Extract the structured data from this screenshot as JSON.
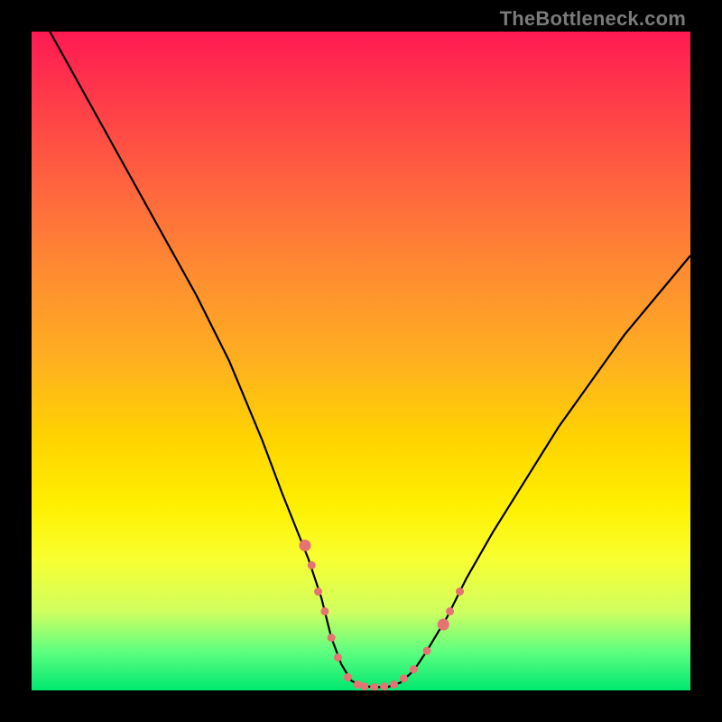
{
  "watermark": "TheBottleneck.com",
  "chart_data": {
    "type": "line",
    "title": "",
    "xlabel": "",
    "ylabel": "",
    "xlim": [
      0,
      100
    ],
    "ylim": [
      0,
      100
    ],
    "grid": false,
    "series": [
      {
        "name": "bottleneck-curve",
        "color": "#000000",
        "x": [
          0,
          5,
          10,
          15,
          20,
          25,
          30,
          35,
          38,
          40,
          42,
          44,
          45.5,
          47,
          48.5,
          50,
          52,
          54,
          56,
          58,
          60,
          63,
          66,
          70,
          75,
          80,
          85,
          90,
          95,
          100
        ],
        "y": [
          105,
          96,
          87,
          78,
          69,
          60,
          50,
          38,
          30,
          25,
          20,
          14,
          8,
          4,
          1.5,
          0.7,
          0.5,
          0.5,
          1.2,
          3,
          6,
          11,
          17,
          24,
          32,
          40,
          47,
          54,
          60,
          66
        ]
      }
    ],
    "markers": {
      "name": "salmon-markers",
      "color": "#e57373",
      "radius_small": 4.5,
      "radius_large": 6.5,
      "points": [
        {
          "x": 41.5,
          "y": 22,
          "r": "large"
        },
        {
          "x": 42.5,
          "y": 19,
          "r": "small"
        },
        {
          "x": 43.5,
          "y": 15,
          "r": "small"
        },
        {
          "x": 44.5,
          "y": 12,
          "r": "small"
        },
        {
          "x": 45.5,
          "y": 8,
          "r": "small"
        },
        {
          "x": 46.5,
          "y": 5,
          "r": "small"
        },
        {
          "x": 48,
          "y": 2,
          "r": "small"
        },
        {
          "x": 49.5,
          "y": 0.9,
          "r": "small"
        },
        {
          "x": 50.5,
          "y": 0.6,
          "r": "small"
        },
        {
          "x": 52,
          "y": 0.5,
          "r": "small"
        },
        {
          "x": 53.5,
          "y": 0.6,
          "r": "small"
        },
        {
          "x": 55,
          "y": 0.9,
          "r": "small"
        },
        {
          "x": 56.5,
          "y": 1.8,
          "r": "small"
        },
        {
          "x": 58,
          "y": 3.2,
          "r": "small"
        },
        {
          "x": 60,
          "y": 6,
          "r": "small"
        },
        {
          "x": 62.5,
          "y": 10,
          "r": "large"
        },
        {
          "x": 63.5,
          "y": 12,
          "r": "small"
        },
        {
          "x": 65,
          "y": 15,
          "r": "small"
        }
      ]
    }
  }
}
